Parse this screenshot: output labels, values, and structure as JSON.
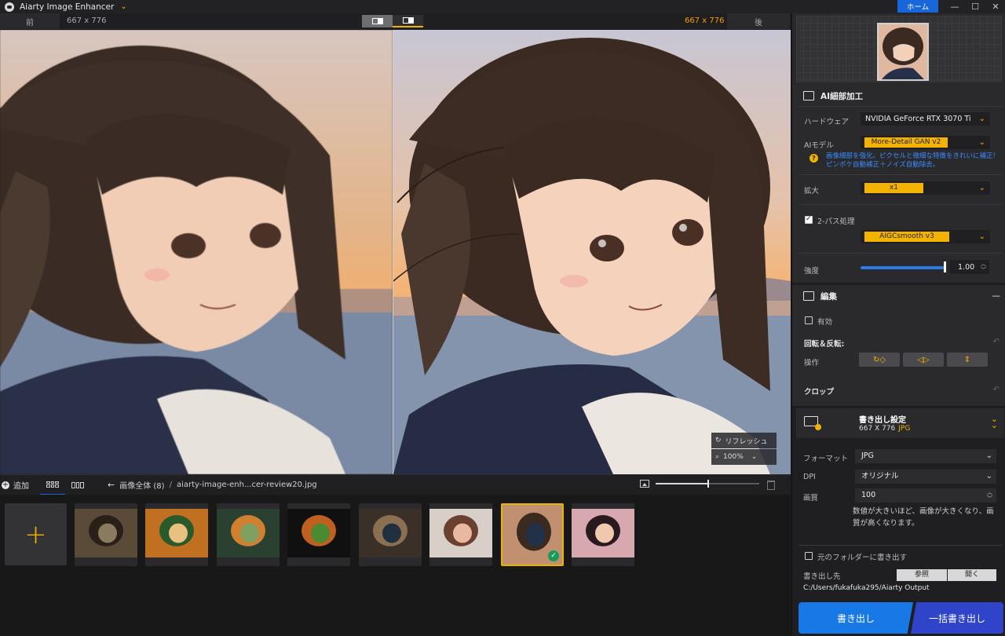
{
  "app": {
    "title": "Aiarty Image Enhancer",
    "home_label": "ホーム"
  },
  "compare": {
    "before_label": "前",
    "after_label": "後",
    "size_before": "667 x 776",
    "size_after": "667 x 776"
  },
  "preview_tools": {
    "refresh_label": "リフレッシュ",
    "zoom_label": "100%"
  },
  "gallery_bar": {
    "add_label": "追加",
    "crumb_root": "画像全体 (8)",
    "crumb_sep": "/",
    "crumb_file": "aiarty-image-enh...cer-review20.jpg",
    "thumb_zoom": 0.5
  },
  "gallery": {
    "add_tile": "+",
    "thumbs": [
      {
        "subject": "butterfly",
        "colors": [
          "#5a4a38",
          "#2a2018",
          "#8a7a60"
        ]
      },
      {
        "subject": "tiger",
        "colors": [
          "#c07020",
          "#2a5a2a",
          "#e8c080"
        ]
      },
      {
        "subject": "lantern-plant",
        "colors": [
          "#2a4030",
          "#d08030",
          "#80a060"
        ]
      },
      {
        "subject": "burger",
        "colors": [
          "#101010",
          "#c06020",
          "#4a8a30"
        ]
      },
      {
        "subject": "steampunk-dog",
        "colors": [
          "#3a3028",
          "#8a7050",
          "#203040"
        ]
      },
      {
        "subject": "woman-portrait",
        "colors": [
          "#d8d0c8",
          "#6a4030",
          "#e8b8a0"
        ]
      },
      {
        "subject": "anime-girl-selected",
        "colors": [
          "#c09070",
          "#3a2a20",
          "#223048"
        ]
      },
      {
        "subject": "anime-girl-sunset",
        "colors": [
          "#d8a8b0",
          "#2a1a20",
          "#f0c8b0"
        ]
      }
    ],
    "selected_check": "✓"
  },
  "ai_panel": {
    "section_title": "AI細部加工",
    "hardware_label": "ハードウェア",
    "hardware_value": "NVIDIA GeForce RTX 3070 Ti",
    "model_label": "AIモデル",
    "model_value": "More-Detail GAN  v2",
    "hint_icon": "?",
    "model_hint": "画像細部を強化。ピクセルと微細な特徴をきれいに補正! ピンボケ自動補正＋ノイズ自動除去。",
    "scale_label": "拡大",
    "scale_value": "x1",
    "two_pass_label": "2-パス処理",
    "two_pass_checked": true,
    "two_pass_model": "AIGCsmooth  v3",
    "strength_label": "強度",
    "strength_value": "1.00",
    "strength_level": 1.0
  },
  "edit_panel": {
    "section_title": "編集",
    "collapse": "—",
    "enable_label": "有効",
    "rotate_title": "回転＆反転:",
    "ops_label": "操作",
    "ops": [
      {
        "icon": "rotate-icon",
        "glyph": "↻◇"
      },
      {
        "icon": "flip-horizontal-icon",
        "glyph": "◁▷"
      },
      {
        "icon": "flip-vertical-icon",
        "glyph": "⇕"
      }
    ],
    "crop_title": "クロップ",
    "undo_glyph": "↶"
  },
  "export": {
    "title": "書き出し設定",
    "size": "667 X 776",
    "format_short": "JPG",
    "format_label": "フォーマット",
    "format_value": "JPG",
    "dpi_label": "DPI",
    "dpi_value": "オリジナル",
    "quality_label": "画質",
    "quality_value": "100",
    "quality_note": "数値が大きいほど、画像が大きくなり、画質が高くなります。",
    "same_folder_label": "元のフォルダーに書き出す",
    "dest_label": "書き出し先",
    "browse_label": "参照",
    "open_label": "開く",
    "path": "C:/Users/fukafuka295/Aiarty Output",
    "export_label": "書き出し",
    "batch_label": "一括書き出し",
    "colors": {
      "accent": "#f3b300",
      "blue": "#1766dc",
      "batch": "#2f44c8"
    }
  }
}
